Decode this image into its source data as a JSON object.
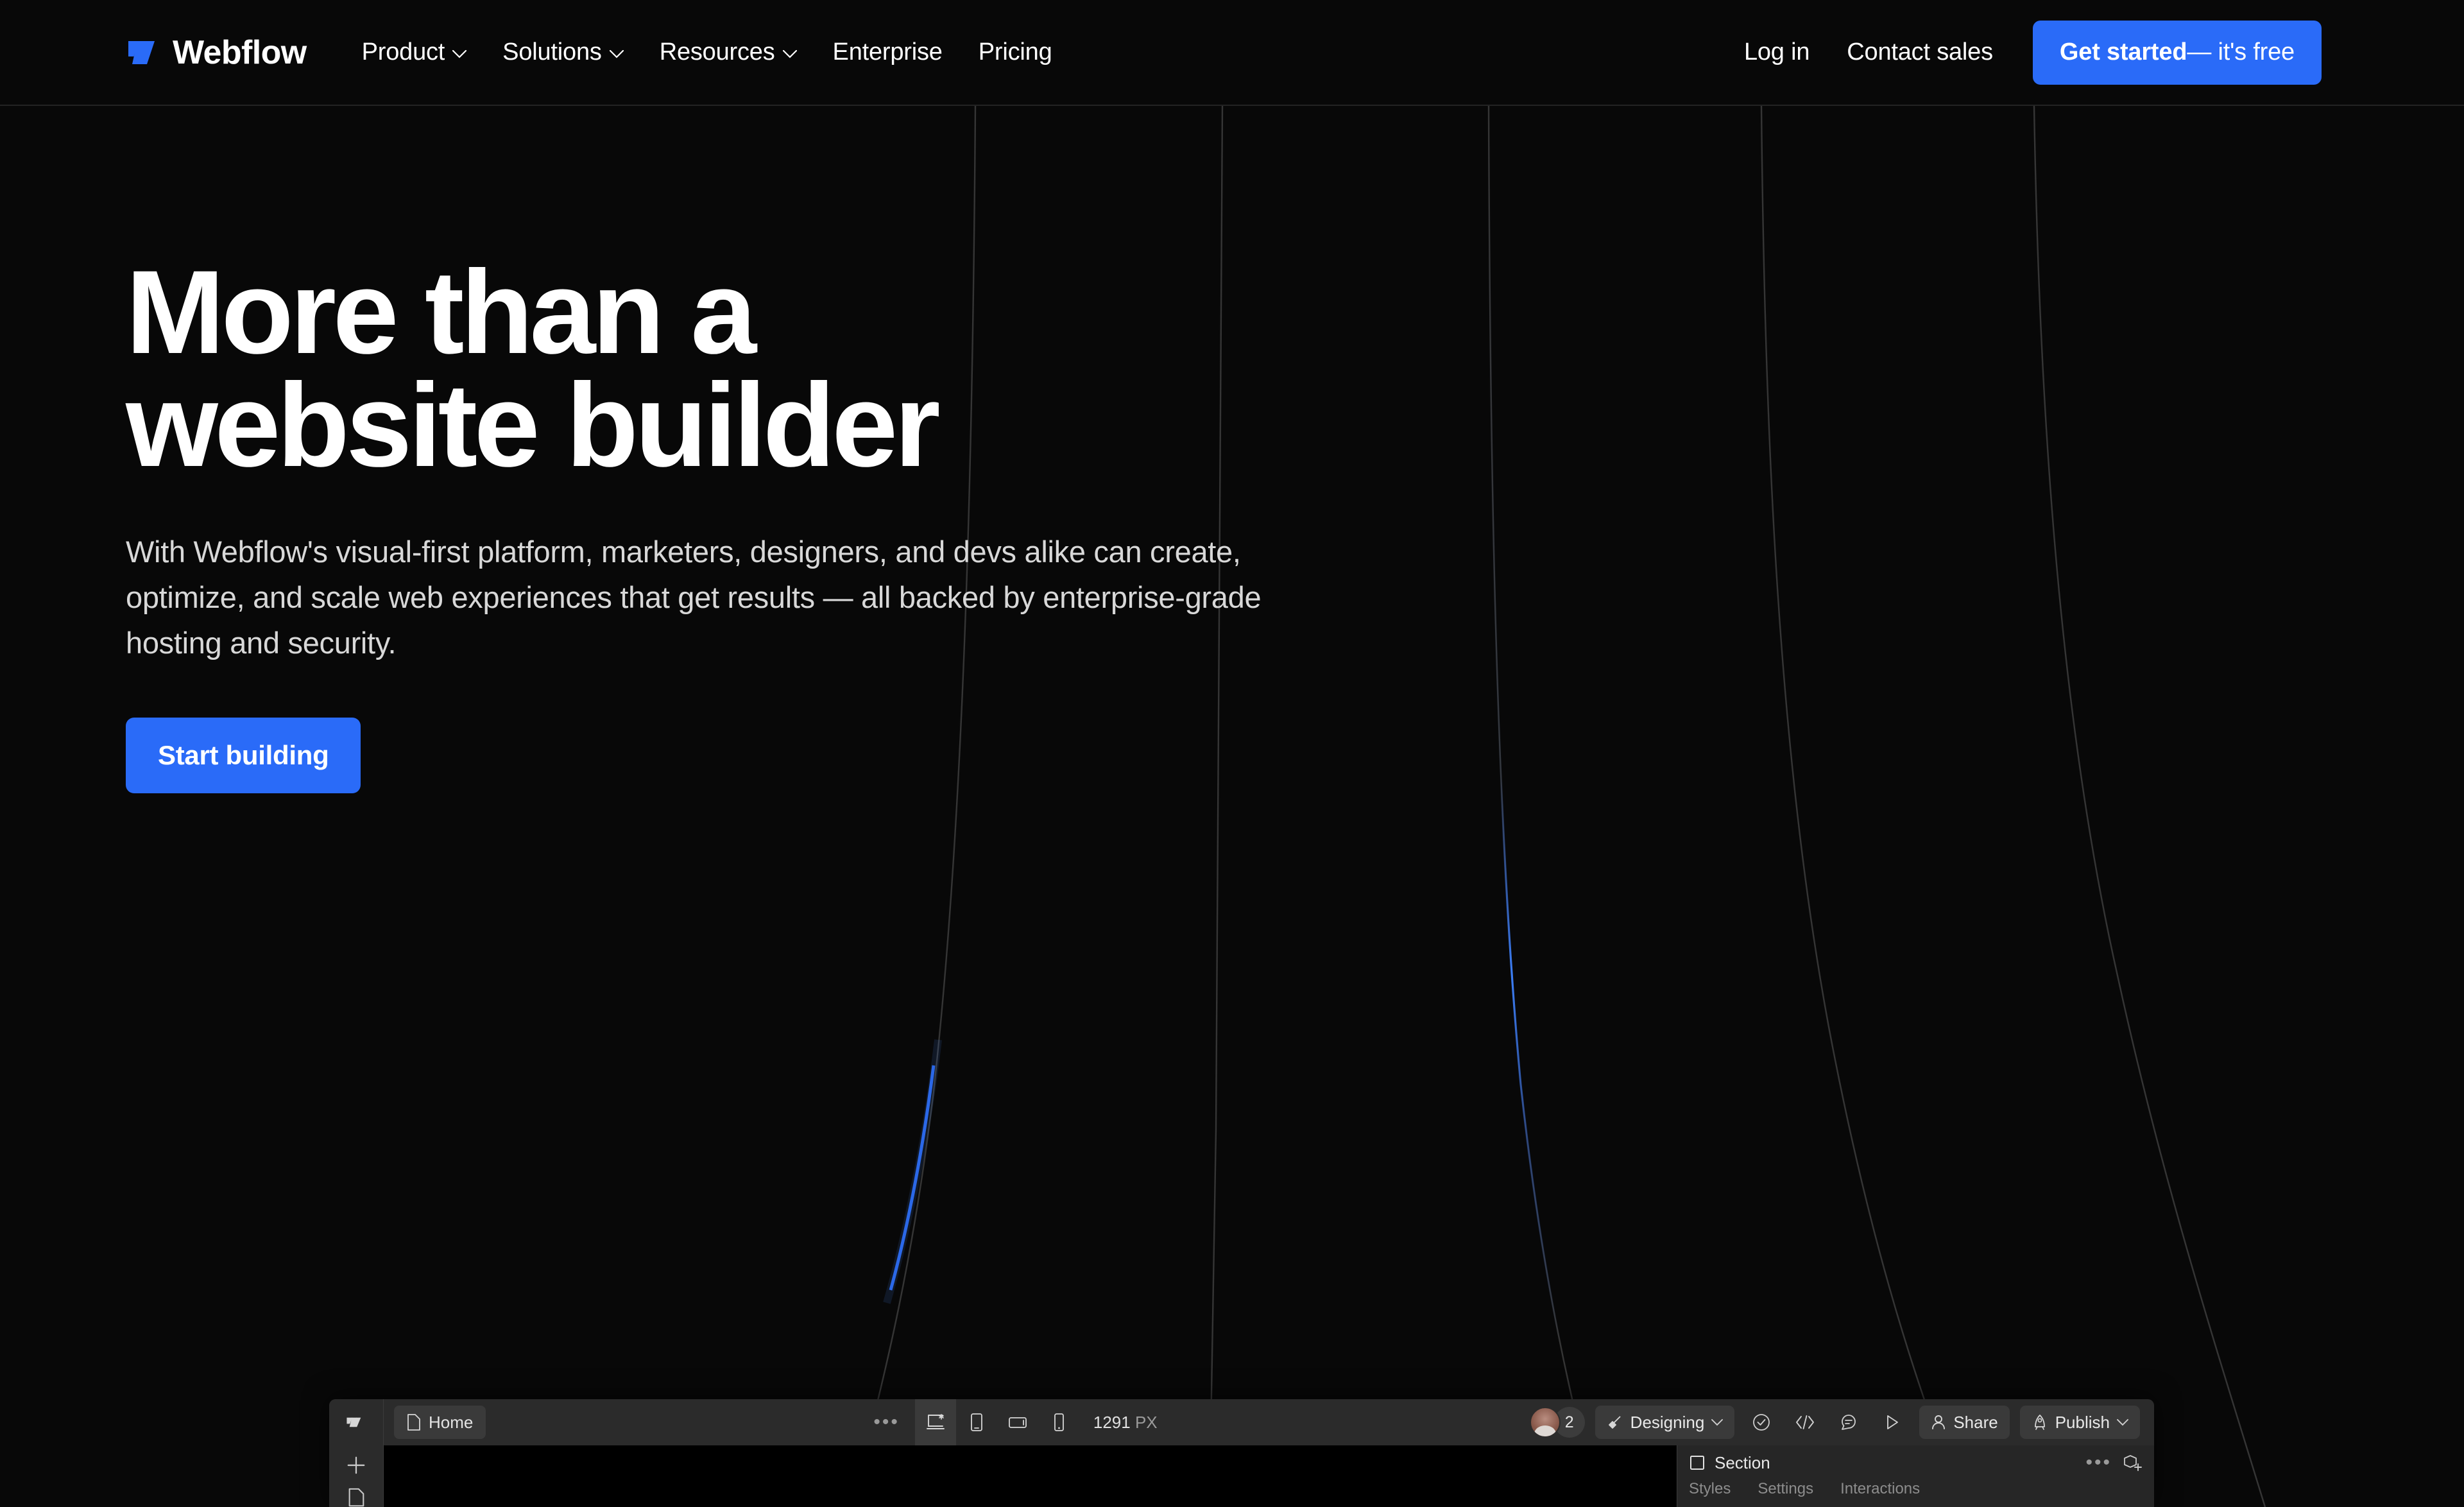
{
  "colors": {
    "background": "#080808",
    "accent_blue": "#2a6bf8",
    "text_primary": "#ffffff",
    "text_secondary": "#d8d8d8",
    "nav_divider": "#232323"
  },
  "navbar": {
    "logo": {
      "wordmark": "Webflow",
      "mark_color": "#2a6bf8"
    },
    "links": [
      {
        "label": "Product",
        "has_dropdown": true
      },
      {
        "label": "Solutions",
        "has_dropdown": true
      },
      {
        "label": "Resources",
        "has_dropdown": true
      },
      {
        "label": "Enterprise",
        "has_dropdown": false
      },
      {
        "label": "Pricing",
        "has_dropdown": false
      }
    ],
    "login_label": "Log in",
    "contact_label": "Contact sales",
    "cta": {
      "strong": "Get started",
      "rest": " — it's free"
    }
  },
  "hero": {
    "title_line1": "More than a",
    "title_line2": "website builder",
    "subtitle": "With Webflow's visual-first platform, marketers, designers, and devs alike can create, optimize, and scale web experiences that get results — all backed by enterprise-grade hosting and security.",
    "cta_label": "Start building"
  },
  "designer": {
    "page_tab": "Home",
    "overflow_dots": "•••",
    "breakpoint_value": "1291",
    "breakpoint_unit": "PX",
    "devices": [
      {
        "name": "desktop-breakpoint",
        "active": true
      },
      {
        "name": "tablet-breakpoint",
        "active": false
      },
      {
        "name": "mobile-landscape-breakpoint",
        "active": false
      },
      {
        "name": "mobile-portrait-breakpoint",
        "active": false
      }
    ],
    "collaborator_count": "2",
    "mode_label": "Designing",
    "share_label": "Share",
    "publish_label": "Publish",
    "panel": {
      "selected_element": "Section",
      "menu_dots": "•••",
      "tabs": [
        "Styles",
        "Settings",
        "Interactions"
      ]
    }
  },
  "background_curves": {
    "line_color": "#3a3a3a",
    "highlight_color": "#2a6bf8",
    "count": 5
  }
}
